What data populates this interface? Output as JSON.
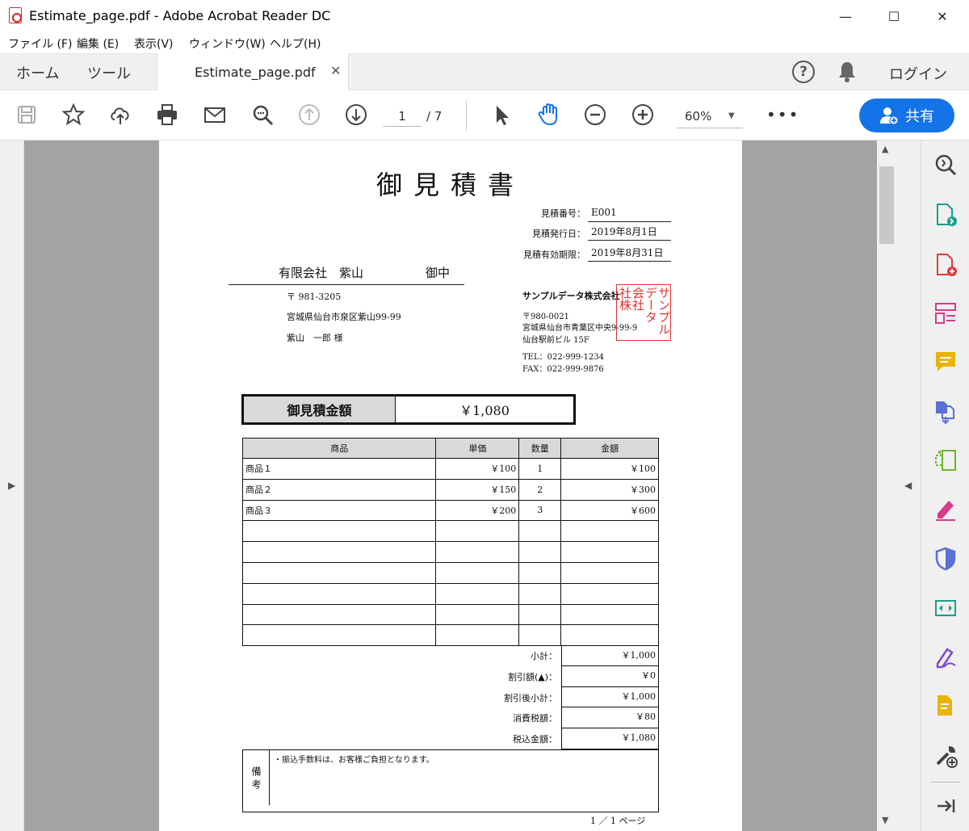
{
  "window": {
    "title": "Estimate_page.pdf - Adobe Acrobat Reader DC",
    "minimize": "—",
    "maximize": "☐",
    "close": "✕"
  },
  "menu": [
    "ファイル (F)",
    "編集 (E)",
    "表示(V)",
    "ウィンドウ(W)",
    "ヘルプ(H)"
  ],
  "tabs": {
    "home": "ホーム",
    "tools": "ツール",
    "document": "Estimate_page.pdf",
    "doc_close": "✕",
    "help": "?",
    "login": "ログイン"
  },
  "toolbar": {
    "page_current": "1",
    "page_total": "/ 7",
    "zoom": "60%",
    "more": "•••",
    "share_label": "共有"
  },
  "colors": {
    "accent": "#1473e6",
    "stamp": "#d33333"
  },
  "document": {
    "title": "御見積書",
    "meta": [
      {
        "label": "見積番号：",
        "value": "E001"
      },
      {
        "label": "見積発行日：",
        "value": "2019年8月1日"
      },
      {
        "label": "見積有効期限：",
        "value": "2019年8月31日"
      }
    ],
    "customer": {
      "name": "有限会社　紫山",
      "suffix": "御中",
      "postal": "〒 981-3205",
      "address": "宮城県仙台市泉区紫山99-99",
      "person": "紫山　一郎 様"
    },
    "issuer": {
      "name": "サンプルデータ株式会社",
      "postal": "〒980-0021",
      "address1": "宮城県仙台市青葉区中央9-99-9",
      "address2": "仙台駅前ビル 15F",
      "tel": "TEL：022-999-1234",
      "fax": "FAX：022-999-9876",
      "stamp": [
        "サンプル",
        "データ",
        "会社",
        "社株"
      ]
    },
    "total": {
      "label": "御見積金額",
      "value": "￥1,080"
    },
    "table": {
      "headers": [
        "商品",
        "単価",
        "数量",
        "金額"
      ],
      "rows": [
        [
          "商品１",
          "￥100",
          "1",
          "￥100"
        ],
        [
          "商品２",
          "￥150",
          "2",
          "￥300"
        ],
        [
          "商品３",
          "￥200",
          "3",
          "￥600"
        ],
        [
          "",
          "",
          "",
          ""
        ],
        [
          "",
          "",
          "",
          ""
        ],
        [
          "",
          "",
          "",
          ""
        ],
        [
          "",
          "",
          "",
          ""
        ],
        [
          "",
          "",
          "",
          ""
        ],
        [
          "",
          "",
          "",
          ""
        ]
      ]
    },
    "summary": [
      {
        "label": "小計：",
        "value": "￥1,000"
      },
      {
        "label": "割引額(▲)：",
        "value": "￥0"
      },
      {
        "label": "割引後小計：",
        "value": "￥1,000"
      },
      {
        "label": "消費税額：",
        "value": "￥80"
      },
      {
        "label": "税込金額：",
        "value": "￥1,080"
      }
    ],
    "notes_label": "備考",
    "notes_text": "・振込手数料は、お客様ご負担となります。",
    "page_number": "1 ／ 1 ページ"
  }
}
